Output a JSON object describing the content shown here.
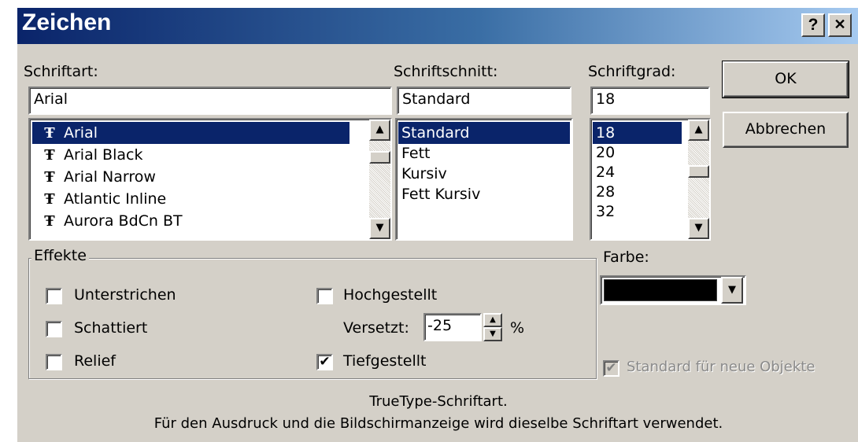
{
  "window": {
    "title": "Zeichen",
    "help_label": "?",
    "close_label": "✕"
  },
  "font": {
    "label": "Schriftart:",
    "value": "Arial",
    "items": [
      {
        "icon": "truetype-icon",
        "label": "Arial",
        "selected": true
      },
      {
        "icon": "truetype-icon",
        "label": "Arial Black"
      },
      {
        "icon": "truetype-icon",
        "label": "Arial Narrow"
      },
      {
        "icon": "truetype-icon",
        "label": "Atlantic Inline"
      },
      {
        "icon": "truetype-icon",
        "label": "Aurora BdCn BT"
      }
    ],
    "icon_glyph": "Ŧ"
  },
  "style": {
    "label": "Schriftschnitt:",
    "value": "Standard",
    "items": [
      "Standard",
      "Fett",
      "Kursiv",
      "Fett Kursiv"
    ]
  },
  "size": {
    "label": "Schriftgrad:",
    "value": "18",
    "items": [
      "18",
      "20",
      "24",
      "28",
      "32"
    ]
  },
  "buttons": {
    "ok": "OK",
    "cancel": "Abbrechen"
  },
  "effects": {
    "label": "Effekte",
    "underline": {
      "label": "Unterstrichen",
      "checked": false
    },
    "shadow": {
      "label": "Schattiert",
      "checked": false
    },
    "emboss": {
      "label": "Relief",
      "checked": false
    },
    "superscript": {
      "label": "Hochgestellt",
      "checked": false
    },
    "offset_label": "Versetzt:",
    "offset_value": "-25",
    "offset_unit": "%",
    "subscript": {
      "label": "Tiefgestellt",
      "checked": true
    },
    "check_glyph": "✔"
  },
  "color": {
    "label": "Farbe:",
    "value": "#000000"
  },
  "default_new": {
    "label": "Standard für neue Objekte",
    "checked": true,
    "disabled": true
  },
  "info": {
    "line1": "TrueType-Schriftart.",
    "line2": "Für den Ausdruck und die Bildschirmanzeige wird dieselbe Schriftart verwendet."
  },
  "colors": {
    "selection": "#0a246a",
    "face": "#d4d0c8",
    "title_start": "#0a246a",
    "title_end": "#a6caf0"
  }
}
